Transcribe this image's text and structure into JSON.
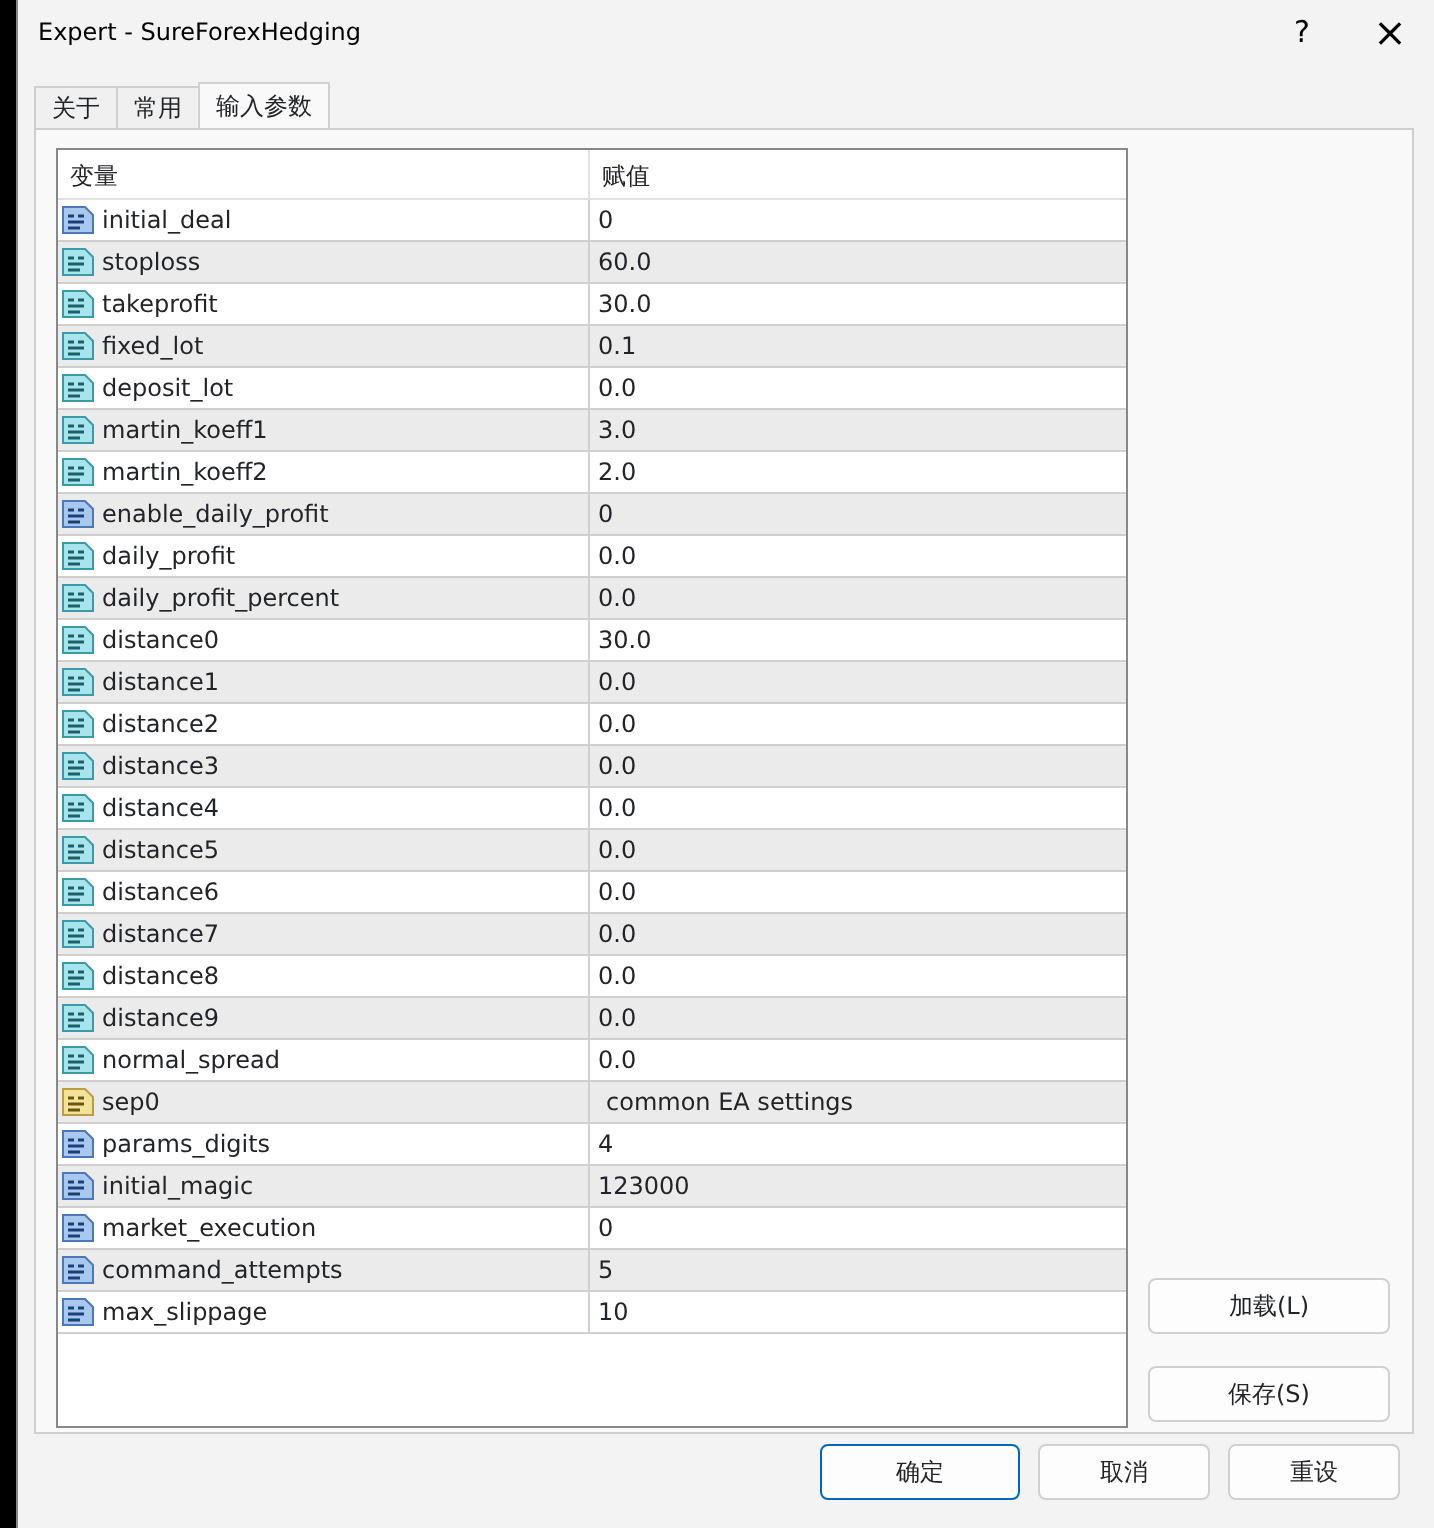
{
  "window": {
    "title": "Expert - SureForexHedging",
    "help_glyph": "?",
    "close_glyph": "×"
  },
  "tabs": [
    {
      "label": "关于",
      "selected": false
    },
    {
      "label": "常用",
      "selected": false
    },
    {
      "label": "输入参数",
      "selected": true
    }
  ],
  "table": {
    "columns": [
      "变量",
      "赋值"
    ],
    "rows": [
      {
        "kind": "int",
        "name": "initial_deal",
        "value": "0"
      },
      {
        "kind": "double",
        "name": "stoploss",
        "value": "60.0"
      },
      {
        "kind": "double",
        "name": "takeprofit",
        "value": "30.0"
      },
      {
        "kind": "double",
        "name": "fixed_lot",
        "value": "0.1"
      },
      {
        "kind": "double",
        "name": "deposit_lot",
        "value": "0.0"
      },
      {
        "kind": "double",
        "name": "martin_koeff1",
        "value": "3.0"
      },
      {
        "kind": "double",
        "name": "martin_koeff2",
        "value": "2.0"
      },
      {
        "kind": "int",
        "name": "enable_daily_profit",
        "value": "0"
      },
      {
        "kind": "double",
        "name": "daily_profit",
        "value": "0.0"
      },
      {
        "kind": "double",
        "name": "daily_profit_percent",
        "value": "0.0"
      },
      {
        "kind": "double",
        "name": "distance0",
        "value": "30.0"
      },
      {
        "kind": "double",
        "name": "distance1",
        "value": "0.0"
      },
      {
        "kind": "double",
        "name": "distance2",
        "value": "0.0"
      },
      {
        "kind": "double",
        "name": "distance3",
        "value": "0.0"
      },
      {
        "kind": "double",
        "name": "distance4",
        "value": "0.0"
      },
      {
        "kind": "double",
        "name": "distance5",
        "value": "0.0"
      },
      {
        "kind": "double",
        "name": "distance6",
        "value": "0.0"
      },
      {
        "kind": "double",
        "name": "distance7",
        "value": "0.0"
      },
      {
        "kind": "double",
        "name": "distance8",
        "value": "0.0"
      },
      {
        "kind": "double",
        "name": "distance9",
        "value": "0.0"
      },
      {
        "kind": "double",
        "name": "normal_spread",
        "value": "0.0"
      },
      {
        "kind": "string",
        "name": "sep0",
        "value": "common EA settings"
      },
      {
        "kind": "int",
        "name": "params_digits",
        "value": "4"
      },
      {
        "kind": "int",
        "name": "initial_magic",
        "value": "123000"
      },
      {
        "kind": "int",
        "name": "market_execution",
        "value": "0"
      },
      {
        "kind": "int",
        "name": "command_attempts",
        "value": "5"
      },
      {
        "kind": "int",
        "name": "max_slippage",
        "value": "10"
      }
    ]
  },
  "side_buttons": [
    "加载(L)",
    "保存(S)"
  ],
  "buttons": [
    {
      "label": "确定",
      "default": true
    },
    {
      "label": "取消",
      "default": false
    },
    {
      "label": "重设",
      "default": false
    }
  ]
}
